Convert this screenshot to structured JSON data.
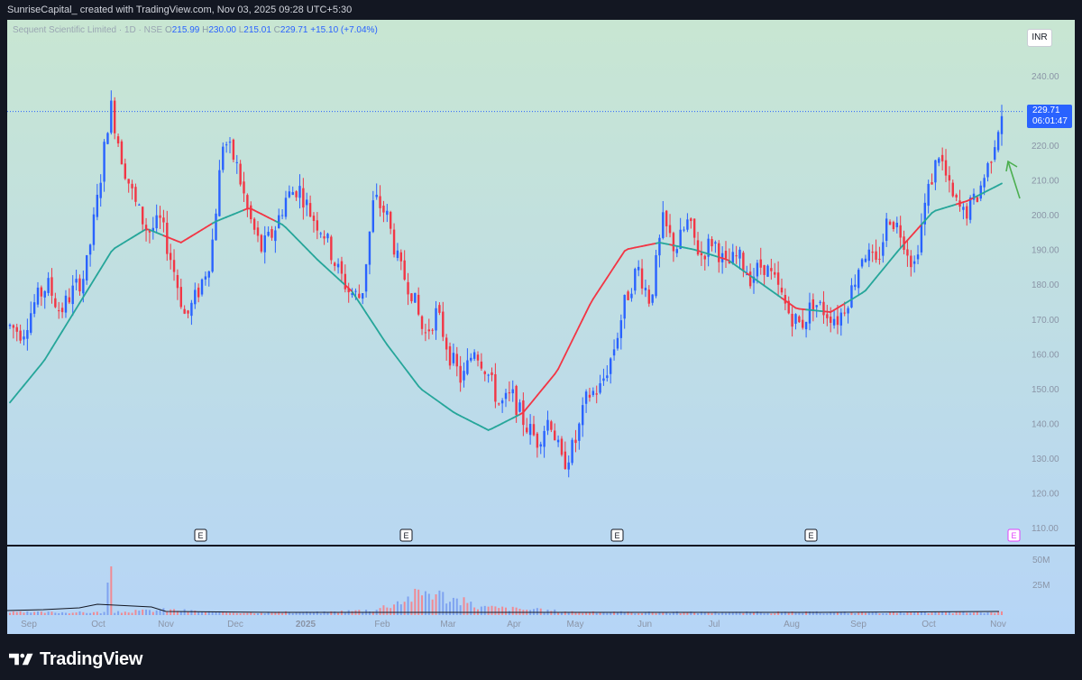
{
  "header": {
    "text": "SunriseCapital_ created with TradingView.com, Nov 03, 2025 09:28 UTC+5:30"
  },
  "legend": {
    "symbol": "Sequent Scientific Limited · 1D · NSE",
    "open_label": "O",
    "open": "215.99",
    "high_label": "H",
    "high": "230.00",
    "low_label": "L",
    "low": "215.01",
    "close_label": "C",
    "close": "229.71",
    "change": "+15.10 (+7.04%)"
  },
  "currency": "INR",
  "last_price": {
    "price": "229.71",
    "countdown": "06:01:47"
  },
  "footer": {
    "brand": "TradingView"
  },
  "colors": {
    "up": "#2962ff",
    "down": "#f23645",
    "ma_below": "#26a69a",
    "ma_above": "#f23645",
    "bg_top": "#c8e6d2",
    "bg_bottom": "#b6d5f7",
    "annotation_arrow": "#4caf50"
  },
  "chart_data": {
    "type": "candlestick",
    "y_axis": {
      "min": 105,
      "max": 250,
      "ticks": [
        "110.00",
        "120.00",
        "130.00",
        "140.00",
        "150.00",
        "160.00",
        "170.00",
        "180.00",
        "190.00",
        "200.00",
        "210.00",
        "220.00",
        "230.00",
        "240.00"
      ]
    },
    "volume_axis": {
      "ticks": [
        "25M",
        "50M"
      ]
    },
    "x_ticks": [
      "Sep",
      "Oct",
      "Nov",
      "Dec",
      "2025",
      "Feb",
      "Mar",
      "Apr",
      "May",
      "Jun",
      "Jul",
      "Aug",
      "Sep",
      "Oct",
      "Nov"
    ],
    "earnings_markers": [
      "E",
      "E",
      "E",
      "E",
      "E"
    ],
    "price_anchors": [
      [
        "Sep",
        168
      ],
      [
        "Sep",
        166
      ],
      [
        "Sep",
        175
      ],
      [
        "Sep",
        180
      ],
      [
        "Sep",
        172
      ],
      [
        "Sep",
        178
      ],
      [
        "Oct",
        183
      ],
      [
        "Oct",
        205
      ],
      [
        "Oct",
        232
      ],
      [
        "Oct",
        215
      ],
      [
        "Oct",
        203
      ],
      [
        "Oct",
        195
      ],
      [
        "Oct",
        198
      ],
      [
        "Oct",
        185
      ],
      [
        "Oct",
        170
      ],
      [
        "Nov",
        178
      ],
      [
        "Nov",
        188
      ],
      [
        "Nov",
        222
      ],
      [
        "Nov",
        215
      ],
      [
        "Nov",
        200
      ],
      [
        "Nov",
        190
      ],
      [
        "Nov",
        195
      ],
      [
        "Dec",
        205
      ],
      [
        "Dec",
        208
      ],
      [
        "Dec",
        200
      ],
      [
        "Dec",
        195
      ],
      [
        "Dec",
        185
      ],
      [
        "Dec",
        178
      ],
      [
        "Dec",
        176
      ],
      [
        "Dec",
        205
      ],
      [
        "2025",
        200
      ],
      [
        "2025",
        185
      ],
      [
        "2025",
        178
      ],
      [
        "2025",
        165
      ],
      [
        "Feb",
        172
      ],
      [
        "Feb",
        160
      ],
      [
        "Feb",
        152
      ],
      [
        "Feb",
        162
      ],
      [
        "Mar",
        155
      ],
      [
        "Mar",
        145
      ],
      [
        "Mar",
        148
      ],
      [
        "Mar",
        140
      ],
      [
        "Mar",
        135
      ],
      [
        "Apr",
        142
      ],
      [
        "Apr",
        128
      ],
      [
        "Apr",
        134
      ],
      [
        "Apr",
        148
      ],
      [
        "Apr",
        150
      ],
      [
        "May",
        160
      ],
      [
        "May",
        175
      ],
      [
        "May",
        185
      ],
      [
        "May",
        175
      ],
      [
        "Jun",
        198
      ],
      [
        "Jun",
        190
      ],
      [
        "Jun",
        198
      ],
      [
        "Jun",
        188
      ],
      [
        "Jul",
        193
      ],
      [
        "Jul",
        185
      ],
      [
        "Jul",
        188
      ],
      [
        "Jul",
        182
      ],
      [
        "Jul",
        186
      ],
      [
        "Aug",
        180
      ],
      [
        "Aug",
        172
      ],
      [
        "Aug",
        168
      ],
      [
        "Aug",
        175
      ],
      [
        "Aug",
        172
      ],
      [
        "Sep",
        170
      ],
      [
        "Sep",
        178
      ],
      [
        "Sep",
        190
      ],
      [
        "Sep",
        185
      ],
      [
        "Sep",
        200
      ],
      [
        "Oct",
        195
      ],
      [
        "Oct",
        185
      ],
      [
        "Oct",
        205
      ],
      [
        "Oct",
        218
      ],
      [
        "Oct",
        205
      ],
      [
        "Oct",
        200
      ],
      [
        "Nov",
        205
      ],
      [
        "Nov",
        215
      ],
      [
        "Nov",
        229.71
      ]
    ],
    "ma_anchors": [
      [
        "Sep",
        146
      ],
      [
        "Sep",
        158
      ],
      [
        "Oct",
        174
      ],
      [
        "Oct",
        190
      ],
      [
        "Oct",
        196
      ],
      [
        "Nov",
        192
      ],
      [
        "Nov",
        198
      ],
      [
        "Dec",
        202
      ],
      [
        "Dec",
        197
      ],
      [
        "2025",
        187
      ],
      [
        "Feb",
        178
      ],
      [
        "Mar",
        163
      ],
      [
        "Mar",
        150
      ],
      [
        "Apr",
        143
      ],
      [
        "Apr",
        138
      ],
      [
        "May",
        143
      ],
      [
        "May",
        155
      ],
      [
        "Jun",
        175
      ],
      [
        "Jun",
        190
      ],
      [
        "Jul",
        192
      ],
      [
        "Jul",
        190
      ],
      [
        "Aug",
        187
      ],
      [
        "Aug",
        180
      ],
      [
        "Sep",
        173
      ],
      [
        "Sep",
        172
      ],
      [
        "Oct",
        178
      ],
      [
        "Oct",
        190
      ],
      [
        "Oct",
        201
      ],
      [
        "Nov",
        204
      ],
      [
        "Nov",
        209
      ]
    ],
    "volume_note": "relative volumes, spike at Oct",
    "volume_values": [
      1,
      1,
      1,
      2,
      1,
      1,
      1,
      2,
      9,
      3,
      2,
      1,
      1,
      1,
      1,
      1,
      1,
      1,
      1,
      1
    ]
  }
}
